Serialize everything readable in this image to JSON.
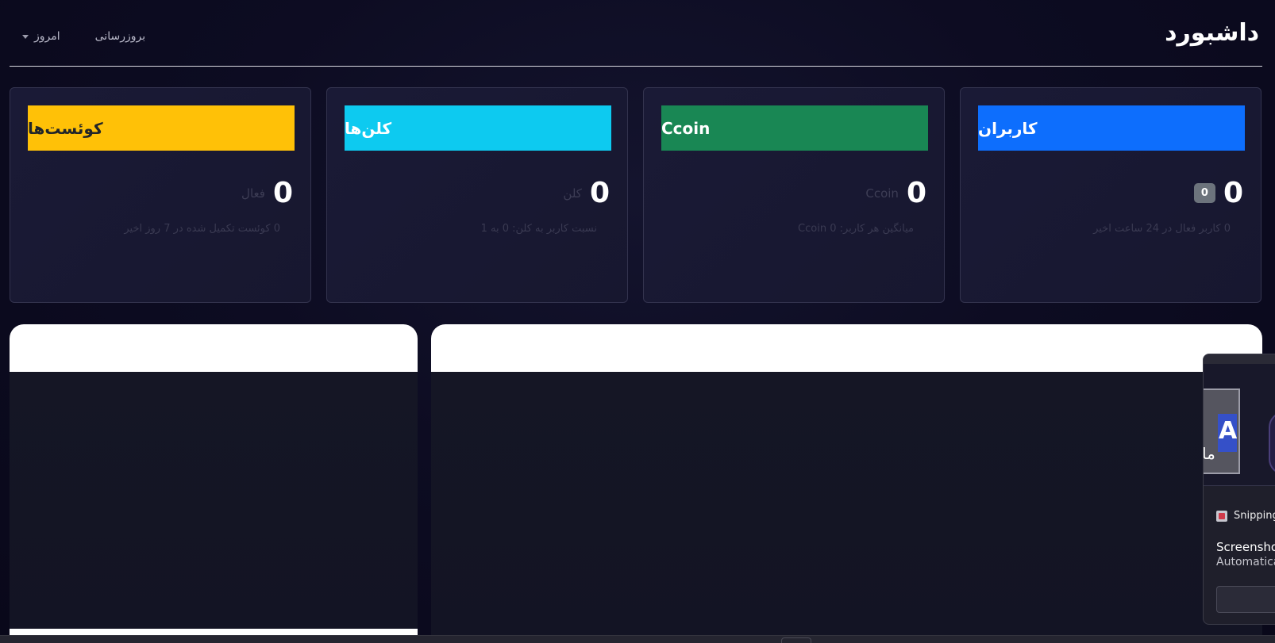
{
  "header": {
    "title": "داشبورد",
    "refresh_label": "بروزرسانی",
    "period_label": "امروز"
  },
  "cards": [
    {
      "title": "کاربران",
      "value": "0",
      "value_label": "",
      "badge": "0",
      "sub": "0 کاربر فعال در 24 ساعت اخیر",
      "color": "#0d6efd"
    },
    {
      "title": "Ccoin",
      "value": "0",
      "value_label": "Ccoin",
      "sub": "میانگین هر کاربر: 0 Ccoin",
      "color": "#198754"
    },
    {
      "title": "کلن‌ها",
      "value": "0",
      "value_label": "کلن",
      "sub": "نسبت کاربر به کلن: 0 به 1",
      "color": "#0dcaf0"
    },
    {
      "title": "کوئست‌ها",
      "value": "0",
      "value_label": "فعال",
      "sub": "0 کوئست تکمیل شده در 7 روز اخیر",
      "color": "#ffc107"
    }
  ],
  "notification": {
    "app_name": "Snipping",
    "title": "Screenshot",
    "text": "Automatica",
    "thumb_letter": "A",
    "thumb_rtl_text": "ما"
  }
}
